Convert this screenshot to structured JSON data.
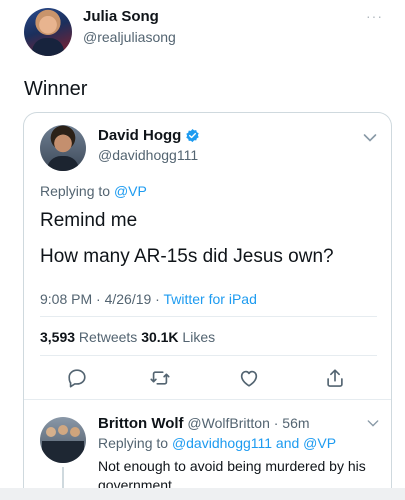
{
  "outer_tweet": {
    "author_name": "Julia Song",
    "author_handle": "@realjuliasong",
    "more_label": "···",
    "text": "Winner"
  },
  "quoted_tweet": {
    "author_name": "David Hogg",
    "author_handle": "@davidhogg111",
    "replying_prefix": "Replying to ",
    "replying_mention": "@VP",
    "line1": "Remind me",
    "line2": "How many AR-15s did Jesus own?",
    "timestamp": "9:08 PM · 4/26/19 · ",
    "source": "Twitter for iPad",
    "retweets_count": "3,593",
    "retweets_label": " Retweets ",
    "likes_count": "30.1K",
    "likes_label": " Likes"
  },
  "reply_tweet": {
    "author_name": "Britton Wolf",
    "author_handle": " @WolfBritton · 56m",
    "replying_prefix": "Replying to ",
    "replying_mentions": "@davidhogg111 and @VP",
    "text": "Not enough to avoid being murdered by his government."
  },
  "colors": {
    "accent": "#1d9bf0",
    "secondary_text": "#536471",
    "border": "#cfd9de"
  },
  "icons": [
    "verified-icon",
    "chevron-down-icon",
    "reply-icon",
    "retweet-icon",
    "like-icon",
    "share-icon"
  ]
}
